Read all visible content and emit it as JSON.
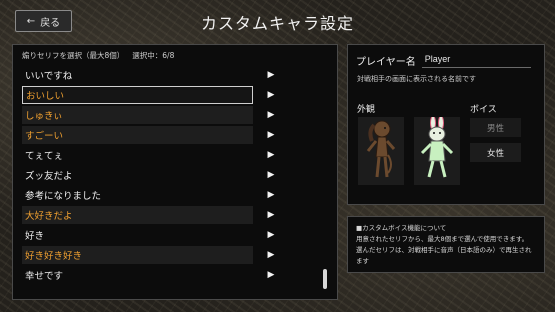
{
  "header": {
    "back_label": "戻る",
    "back_icon": "arrow-left-icon",
    "title": "カスタムキャラ設定"
  },
  "lines": {
    "header_label": "煽りセリフを選択（最大8個）",
    "selected_label": "選択中：6/8",
    "items": [
      {
        "text": "いいですね",
        "selected": false,
        "focused": false
      },
      {
        "text": "おいしい",
        "selected": true,
        "focused": true
      },
      {
        "text": "しゅきぃ",
        "selected": true,
        "focused": false
      },
      {
        "text": "すごーい",
        "selected": true,
        "focused": false
      },
      {
        "text": "てぇてぇ",
        "selected": false,
        "focused": false
      },
      {
        "text": "ズッ友だよ",
        "selected": false,
        "focused": false
      },
      {
        "text": "参考になりました",
        "selected": false,
        "focused": false
      },
      {
        "text": "大好きだよ",
        "selected": true,
        "focused": false
      },
      {
        "text": "好き",
        "selected": false,
        "focused": false
      },
      {
        "text": "好き好き好き",
        "selected": true,
        "focused": false
      },
      {
        "text": "幸せです",
        "selected": false,
        "focused": false
      }
    ],
    "play_icon": "play-icon",
    "play_glyph": "▶"
  },
  "profile": {
    "name_label": "プレイヤー名",
    "name_value": "Player",
    "name_note": "対戦相手の画面に表示される名前です",
    "appearance_label": "外観",
    "voice_label": "ボイス",
    "voice_male": "男性",
    "voice_female": "女性",
    "characters": [
      "dog-character",
      "rabbit-character"
    ]
  },
  "info": {
    "title": "■カスタムボイス機能について",
    "line1": "用意されたセリフから、最大8個まで選んで使用できます。",
    "line2": "選んだセリフは、対戦相手に音声（日本語のみ）で再生されます"
  },
  "colors": {
    "selected_text": "#f0a030",
    "normal_text": "#f0f0f0",
    "panel_bg": "#0c0c0c"
  }
}
